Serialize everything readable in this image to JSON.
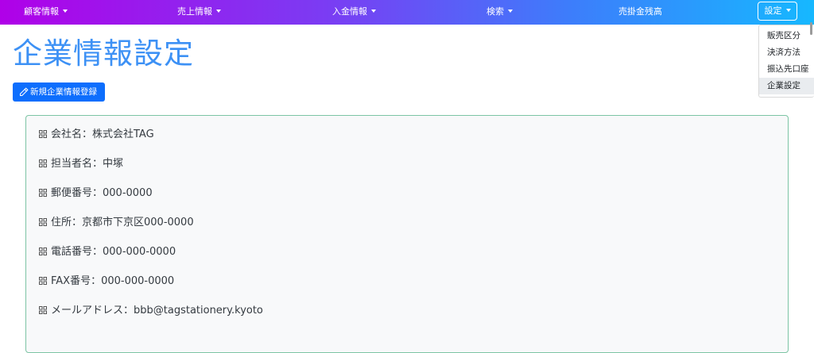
{
  "navbar": {
    "items": [
      {
        "label": "顧客情報",
        "has_dropdown": true
      },
      {
        "label": "売上情報",
        "has_dropdown": true
      },
      {
        "label": "入金情報",
        "has_dropdown": true
      },
      {
        "label": "検索",
        "has_dropdown": true
      },
      {
        "label": "売掛金残高",
        "has_dropdown": false
      }
    ],
    "settings_label": "設定"
  },
  "settings_menu": {
    "items": [
      "販売区分",
      "決済方法",
      "振込先口座",
      "企業設定"
    ],
    "active_item": "企業設定"
  },
  "page": {
    "title": "企業情報設定",
    "new_button_label": "新規企業情報登録"
  },
  "company_info": {
    "rows": [
      "会社名：株式会社TAG",
      "担当者名：中塚",
      "郵便番号：000-0000",
      "住所：京都市下京区000-0000",
      "電話番号：000-000-0000",
      "FAX番号：000-000-0000",
      "メールアドレス：bbb@tagstationery.kyoto"
    ],
    "row_icon": "grid-icon"
  },
  "colors": {
    "navbar_gradient": [
      "#b000e8",
      "#7b3cf3",
      "#3d7dfb",
      "#16b8ff"
    ],
    "title": "#3d91f5",
    "primary_button": "#0d6efd",
    "card_border": "#7cc4a4",
    "card_background": "#f8f9fa"
  }
}
